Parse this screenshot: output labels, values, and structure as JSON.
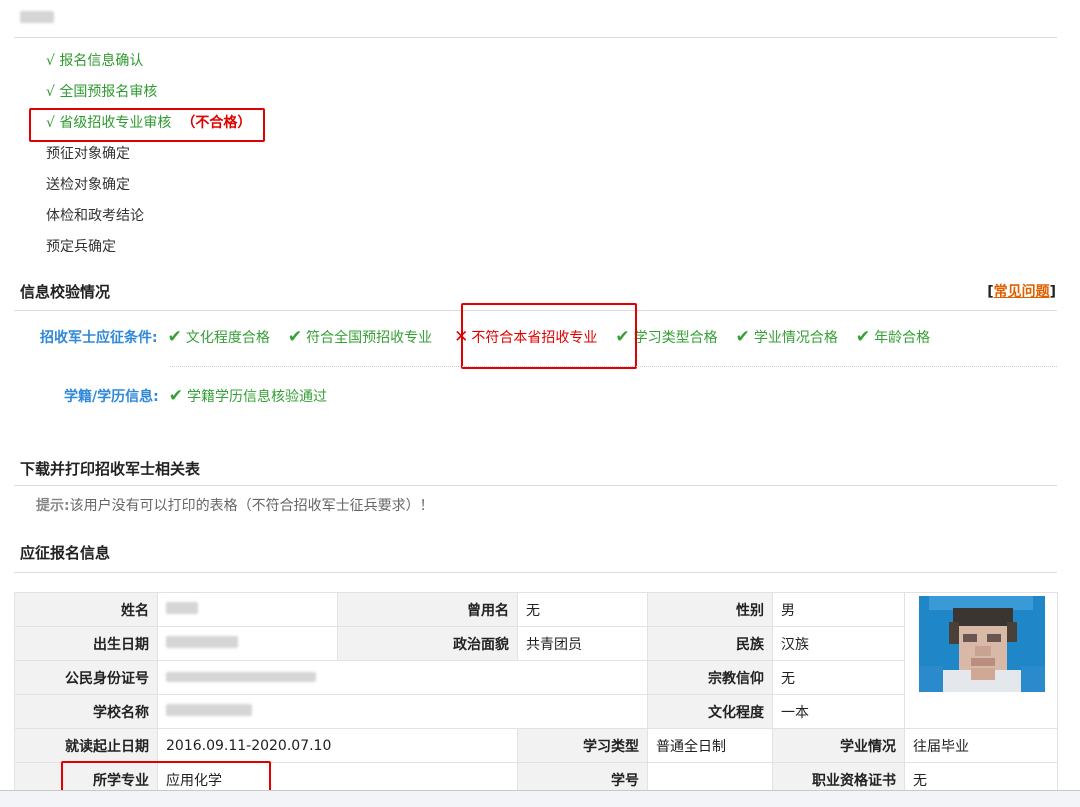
{
  "header": {
    "logo_text": ""
  },
  "steps": [
    {
      "label": "报名信息确认",
      "done": true
    },
    {
      "label": "全国预报名审核",
      "done": true
    },
    {
      "label": "省级招收专业审核",
      "done": true,
      "status": "（不合格）"
    },
    {
      "label": "预征对象确定",
      "done": false
    },
    {
      "label": "送检对象确定",
      "done": false
    },
    {
      "label": "体检和政考结论",
      "done": false
    },
    {
      "label": "预定兵确定",
      "done": false
    }
  ],
  "check_mark": "√",
  "verify": {
    "title": "信息校验情况",
    "faq_open": "[",
    "faq_link": "常见问题",
    "faq_close": "]",
    "conditions_label": "招收军士应征条件:",
    "conditions": [
      {
        "text": "文化程度合格",
        "ok": true
      },
      {
        "text": "符合全国预招收专业",
        "ok": true
      },
      {
        "text": "不符合本省招收专业",
        "ok": false
      },
      {
        "text": "学习类型合格",
        "ok": true
      },
      {
        "text": "学业情况合格",
        "ok": true
      },
      {
        "text": "年龄合格",
        "ok": true
      }
    ],
    "education_label": "学籍/学历信息:",
    "education_items": [
      {
        "text": "学籍学历信息核验通过",
        "ok": true
      }
    ]
  },
  "download": {
    "title": "下载并打印招收军士相关表",
    "tip_label": "提示:",
    "tip_text": "该用户没有可以打印的表格（不符合招收军士征兵要求）！"
  },
  "registration": {
    "title": "应征报名信息",
    "name_label": "姓名",
    "name_value": "",
    "former_name_label": "曾用名",
    "former_name_value": "无",
    "gender_label": "性别",
    "gender_value": "男",
    "birth_label": "出生日期",
    "birth_value": "",
    "political_label": "政治面貌",
    "political_value": "共青团员",
    "ethnicity_label": "民族",
    "ethnicity_value": "汉族",
    "id_label": "公民身份证号",
    "id_value": "",
    "religion_label": "宗教信仰",
    "religion_value": "无",
    "school_label": "学校名称",
    "school_value": "",
    "education_label": "文化程度",
    "education_value": "一本",
    "period_label": "就读起止日期",
    "period_value": "2016.09.11-2020.07.10",
    "study_type_label": "学习类型",
    "study_type_value": "普通全日制",
    "academic_label": "学业情况",
    "academic_value": "往届毕业",
    "major_label": "所学专业",
    "major_value": "应用化学",
    "student_no_label": "学号",
    "student_no_value": "",
    "certificate_label": "职业资格证书",
    "certificate_value": "无"
  },
  "colors": {
    "pass": "#35a035",
    "fail": "#e00000",
    "label_blue": "#2f88d8",
    "link_orange": "#e06000"
  }
}
